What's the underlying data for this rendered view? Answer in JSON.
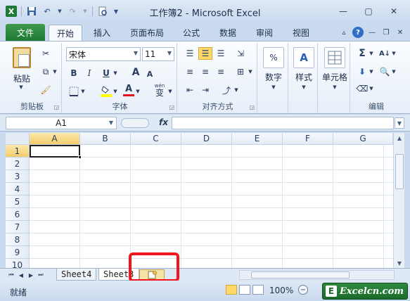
{
  "window": {
    "title": "工作簿2 - Microsoft Excel",
    "logo": "X"
  },
  "quick_access": {
    "icons": [
      "excel-logo",
      "save-icon",
      "undo-icon",
      "redo-icon",
      "print-preview-icon",
      "customize-icon"
    ]
  },
  "tabs": [
    {
      "label": "文件",
      "active": false
    },
    {
      "label": "开始",
      "active": true
    },
    {
      "label": "插入",
      "active": false
    },
    {
      "label": "页面布局",
      "active": false
    },
    {
      "label": "公式",
      "active": false
    },
    {
      "label": "数据",
      "active": false
    },
    {
      "label": "审阅",
      "active": false
    },
    {
      "label": "视图",
      "active": false
    }
  ],
  "ribbon": {
    "clipboard": {
      "paste_label": "粘贴",
      "group_label": "剪贴板"
    },
    "font": {
      "font_name": "宋体",
      "font_size": "11",
      "bold": "B",
      "italic": "I",
      "underline": "U",
      "grow": "A",
      "shrink": "A",
      "font_color": "A",
      "wen": "wén",
      "wen_char": "变",
      "group_label": "字体"
    },
    "alignment": {
      "group_label": "对齐方式"
    },
    "number": {
      "label": "数字",
      "percent": "%"
    },
    "styles": {
      "label": "样式"
    },
    "cells": {
      "label": "单元格"
    },
    "editing": {
      "sigma": "Σ",
      "group_label": "编辑"
    }
  },
  "formula_bar": {
    "name_box": "A1",
    "fx": "fx",
    "value": ""
  },
  "grid": {
    "columns": [
      "A",
      "B",
      "C",
      "D",
      "E",
      "F",
      "G"
    ],
    "rows": [
      "1",
      "2",
      "3",
      "4",
      "5",
      "6",
      "7",
      "8",
      "9",
      "10"
    ],
    "active_cell": "A1"
  },
  "sheets": {
    "tabs": [
      "Sheet4",
      "Sheet3"
    ],
    "active": "Sheet3"
  },
  "status": {
    "ready": "就绪",
    "zoom": "100%",
    "zoom_minus": "−"
  },
  "watermark": {
    "logo": "E",
    "text": "Excelcn.com"
  },
  "colors": {
    "accent_green": "#1f7a35",
    "highlight_red": "#f01620",
    "ribbon_blue": "#c9d9ee"
  }
}
